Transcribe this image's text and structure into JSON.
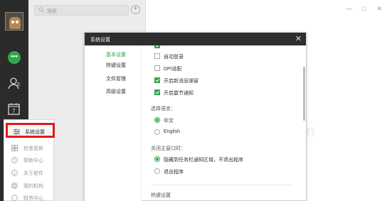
{
  "search": {
    "placeholder": "搜索"
  },
  "window": {
    "minimize": "—",
    "maximize": "□",
    "close": "✕"
  },
  "menu": {
    "items": [
      {
        "label": "系统设置",
        "icon": "sliders-icon"
      },
      {
        "label": "检查更新",
        "icon": "grid-icon"
      },
      {
        "label": "帮助中心",
        "icon": "question-icon"
      },
      {
        "label": "关于软件",
        "icon": "info-icon"
      },
      {
        "label": "我的机构",
        "icon": "building-icon"
      },
      {
        "label": "财务中心",
        "icon": "finance-icon"
      }
    ]
  },
  "ghost_text": "n",
  "dialog": {
    "title": "系统设置",
    "close": "✕",
    "tabs": [
      "基本设置",
      "热键设置",
      "文件管理",
      "高级设置"
    ],
    "options": [
      {
        "label": "自动登录",
        "checked": false
      },
      {
        "label": "DPI适配",
        "checked": false
      },
      {
        "label": "开启新消息弹窗",
        "checked": true
      },
      {
        "label": "开启震节通知",
        "checked": true
      }
    ],
    "language_label": "选择语言：",
    "languages": [
      {
        "label": "中文",
        "selected": true
      },
      {
        "label": "English",
        "selected": false
      }
    ],
    "close_label": "关闭主窗口时：",
    "close_options": [
      {
        "label": "隐藏到任务栏通知区域，不退出程序",
        "selected": true
      },
      {
        "label": "退出程序",
        "selected": false
      }
    ],
    "hotkey_section": "热键设置"
  },
  "colors": {
    "accent": "#2ea84a",
    "highlight": "#e01a1a",
    "rail": "#2b2b2b",
    "title": "#2e2e2e"
  }
}
